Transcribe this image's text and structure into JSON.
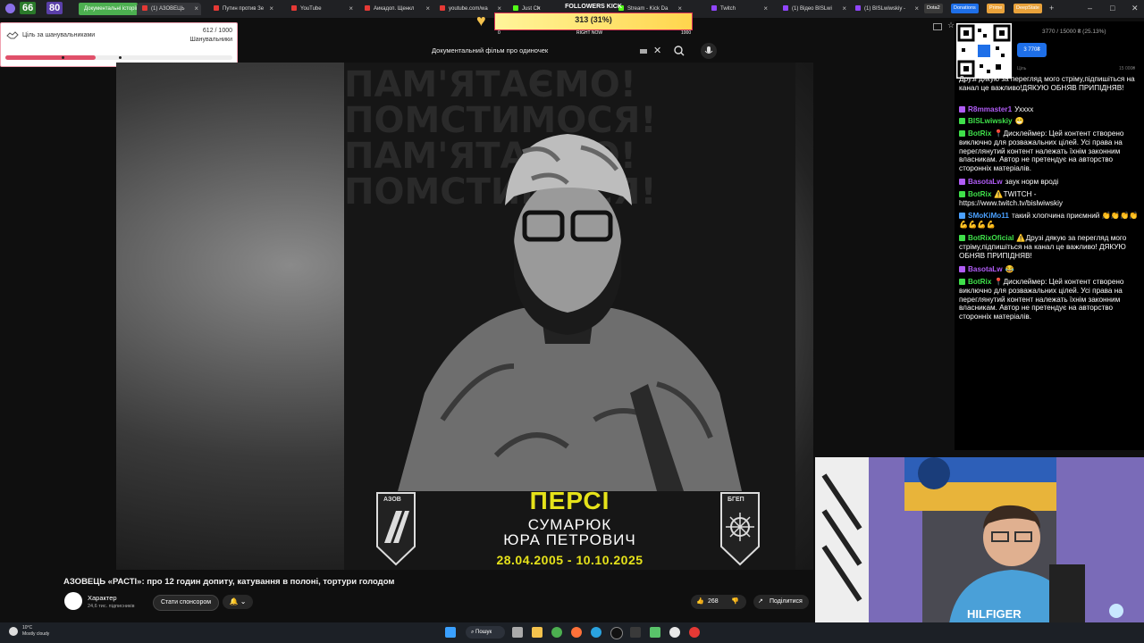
{
  "browser": {
    "counters": [
      {
        "value": "66",
        "color": "#2a7a2a"
      },
      {
        "value": "80",
        "color": "#5a3fa8"
      }
    ],
    "tabs": [
      {
        "label": "Документальні історії",
        "color": "#4caf50"
      },
      {
        "label": "(1) АЗОВЕЦЬ",
        "color": "#e53935"
      },
      {
        "label": "Путин против Зе",
        "color": "#e53935"
      },
      {
        "label": "YouTube",
        "color": "#e53935"
      },
      {
        "label": "Аикадоп. Щенкл",
        "color": "#e53935"
      },
      {
        "label": "youtube.com/wa",
        "color": "#e53935"
      },
      {
        "label": "Just Ch",
        "color": "#53fc18"
      },
      {
        "label": "Stream - Kick Da",
        "color": "#53fc18"
      },
      {
        "label": "Twitch",
        "color": "#9146ff"
      },
      {
        "label": "(1) Відео BISLwi",
        "color": "#9146ff"
      },
      {
        "label": "(1) BISLwiwskiy -",
        "color": "#9146ff"
      }
    ],
    "extensions": [
      {
        "label": "Dota2",
        "color": "#3a3a3a"
      },
      {
        "label": "Donations",
        "color": "#1e6fe8"
      },
      {
        "label": "Prime",
        "color": "#e9a23b"
      },
      {
        "label": "DeepState",
        "color": "#e9a23b"
      }
    ],
    "window_controls": [
      "–",
      "□",
      "✕"
    ]
  },
  "followers_widget": {
    "title": "FOLLOWERS KICK",
    "text": "313 (31%)",
    "axis_min": "0",
    "axis_mid": "RIGHT NOW",
    "axis_max": "1000",
    "progress": 0.313
  },
  "goal": {
    "label": "Ціль за шанувальниками",
    "count": "612 / 1000",
    "sub": "Шанувальники",
    "progress": 0.612
  },
  "search": {
    "query": "Документальний фільм  про одиночек",
    "clear": "✕"
  },
  "poster": {
    "bg_line1": "ПАМ'ЯТАЄМО!",
    "bg_line2": "ПОМСТИМОСЯ!",
    "name": "ПЕРСІ",
    "surname": "СУМАРЮК",
    "fullname": "ЮРА ПЕТРОВИЧ",
    "dates": "28.04.2005 - 10.10.2025",
    "badge_left": "АЗОВ",
    "badge_right": "БГЕП"
  },
  "video_info": {
    "title": "АЗОВЕЦЬ «РАСТІ»: про 12 годин допиту, катування в полоні, тортури голодом",
    "channel": "Характер",
    "subscribers": "24,6 тис. підписників",
    "sponsor_label": "Стати спонсором",
    "likes": "268",
    "share_label": "Поділитися"
  },
  "donation": {
    "progress_text": "3770 / 15000 ₴ (25.13%)",
    "amount": "3 770₴",
    "left_label": "Ціль",
    "right_label": "15 000₴"
  },
  "chat": [
    {
      "user": "",
      "user_color": "#ffffff",
      "text": "Друзі дякую за перегляд мого стріму,підпишіться на канал це важливо!ДЯКУЮ ОБНЯВ ПРИПІДНЯВ!"
    },
    {
      "user": "R8mmaster1",
      "user_color": "#b05cf5",
      "text": "Ухххх"
    },
    {
      "user": "BISLwiwskiy",
      "user_color": "#3fe04a",
      "text": "😁"
    },
    {
      "user": "BotRix",
      "user_color": "#3fe04a",
      "text": "📍Дисклеймер: Цей контент створено виключно для розважальних цілей. Усі права на переглянутий контент належать їхнім законним власникам. Автор не претендує на авторство сторонніх матеріалів."
    },
    {
      "user": "BasotaLw",
      "user_color": "#b05cf5",
      "text": "заук норм вроді"
    },
    {
      "user": "BotRix",
      "user_color": "#3fe04a",
      "text": "⚠️TWITCH - https://www.twitch.tv/bislwiwskiy"
    },
    {
      "user": "SMoKiMo11",
      "user_color": "#4aa0ff",
      "text": "такий хлопчина приємний 👏👏👏👏💪💪💪💪"
    },
    {
      "user": "BotRixOficial",
      "user_color": "#3fe04a",
      "text": "⚠️Друзі дякую за перегляд мого стріму,підпишіться на канал це важливо! ДЯКУЮ ОБНЯВ ПРИПІДНЯВ!"
    },
    {
      "user": "BasotaLw",
      "user_color": "#b05cf5",
      "text": "😂"
    },
    {
      "user": "BotRix",
      "user_color": "#3fe04a",
      "text": "📍Дисклеймер: Цей контент створено виключно для розважальних цілей. Усі права на переглянутий контент належать їхнім законним власникам. Автор не претендує на авторство сторонніх матеріалів."
    }
  ],
  "taskbar": {
    "weather_temp": "10°C",
    "weather_desc": "Mostly cloudy",
    "search_label": "Пошук"
  },
  "webcam": {
    "shirt_text": "HILFIGER"
  },
  "colors": {
    "accent_yellow": "#e6e21a",
    "goal_fill": "#e0506a",
    "kick_green": "#3fe04a"
  }
}
